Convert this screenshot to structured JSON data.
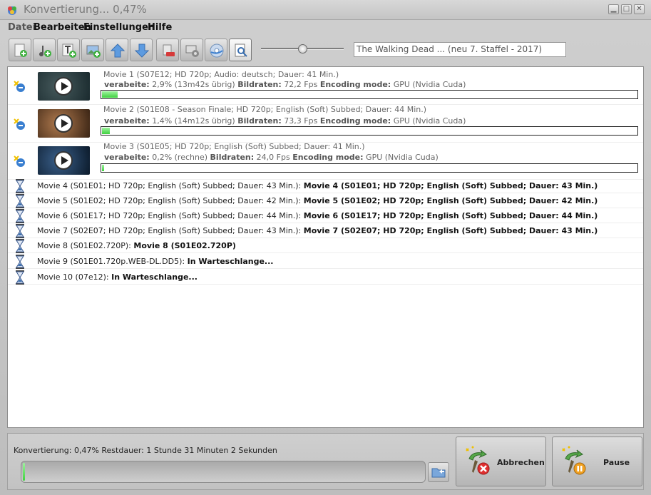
{
  "window": {
    "title": "Konvertierung... 0,47%",
    "controls": {
      "minimize": "▁",
      "maximize": "□",
      "close": "✕"
    }
  },
  "menu": [
    "Datei",
    "Bearbeiten",
    "Einstellungen",
    "Hilfe"
  ],
  "toolbar": {
    "title_field": "The Walking Dead ... (neu 7. Staffel - 2017)",
    "buttons": [
      "add-file",
      "add-folder",
      "add-text",
      "add-screenshot",
      "move-up",
      "move-down",
      "remove",
      "encode-settings",
      "burn-disc",
      "preview"
    ]
  },
  "active_items": [
    {
      "line1": "Movie 1 (S07E12; HD 720p; Audio: deutsch; Dauer: 41 Min.)",
      "progress_label": "verabeite:",
      "progress_text": "2,9% (13m42s übrig)",
      "fps_label": "Bildraten:",
      "fps": "72,2 Fps",
      "mode_label": "Encoding mode:",
      "mode": "GPU (Nvidia Cuda)",
      "progress": 2.9,
      "thumb_colors": [
        "#1a2a2e",
        "#465a5c"
      ]
    },
    {
      "line1": "Movie 2 (S01E08 - Season Finale; HD 720p; English (Soft) Subbed; Dauer: 44 Min.)",
      "progress_label": "verabeite:",
      "progress_text": "1,4% (14m12s übrig)",
      "fps_label": "Bildraten:",
      "fps": "73,3 Fps",
      "mode_label": "Encoding mode:",
      "mode": "GPU (Nvidia Cuda)",
      "progress": 1.4,
      "thumb_colors": [
        "#3a2414",
        "#b07a4e"
      ]
    },
    {
      "line1": "Movie 3 (S01E05; HD 720p; English (Soft) Subbed; Dauer: 41 Min.)",
      "progress_label": "verabeite:",
      "progress_text": "0,2% (rechne)",
      "fps_label": "Bildraten:",
      "fps": "24,0 Fps",
      "mode_label": "Encoding mode:",
      "mode": "GPU (Nvidia Cuda)",
      "progress": 0.2,
      "thumb_colors": [
        "#0b1a2a",
        "#3a5f8a"
      ]
    }
  ],
  "queue": [
    {
      "name": "Movie 4 (S01E01; HD 720p; English (Soft) Subbed; Dauer: 43 Min.):",
      "status": "Movie 4 (S01E01; HD 720p; English (Soft) Subbed; Dauer: 43 Min.)"
    },
    {
      "name": "Movie 5 (S01E02; HD 720p; English (Soft) Subbed; Dauer: 42 Min.):",
      "status": "Movie 5 (S01E02; HD 720p; English (Soft) Subbed; Dauer: 42 Min.)"
    },
    {
      "name": "Movie 6 (S01E17; HD 720p; English (Soft) Subbed; Dauer: 44 Min.):",
      "status": "Movie 6 (S01E17; HD 720p; English (Soft) Subbed; Dauer: 44 Min.)"
    },
    {
      "name": "Movie 7 (S02E07; HD 720p; English (Soft) Subbed; Dauer: 43 Min.):",
      "status": "Movie 7 (S02E07; HD 720p; English (Soft) Subbed; Dauer: 43 Min.)"
    },
    {
      "name": "Movie 8 (S01E02.720P):",
      "status": "Movie 8 (S01E02.720P)"
    },
    {
      "name": "Movie 9 (S01E01.720p.WEB-DL.DD5):",
      "status": "In Warteschlange..."
    },
    {
      "name": "Movie 10 (07e12):",
      "status": "In Warteschlange..."
    }
  ],
  "footer": {
    "status": "Konvertierung: 0,47% Restdauer: 1 Stunde 31 Minuten 2 Sekunden",
    "overall_progress": 0.47,
    "abort_label": "Abbrechen",
    "pause_label": "Pause"
  },
  "colors": {
    "progress_green": "#3fd13f",
    "abort_red": "#e03030",
    "pause_orange": "#f0a020"
  }
}
